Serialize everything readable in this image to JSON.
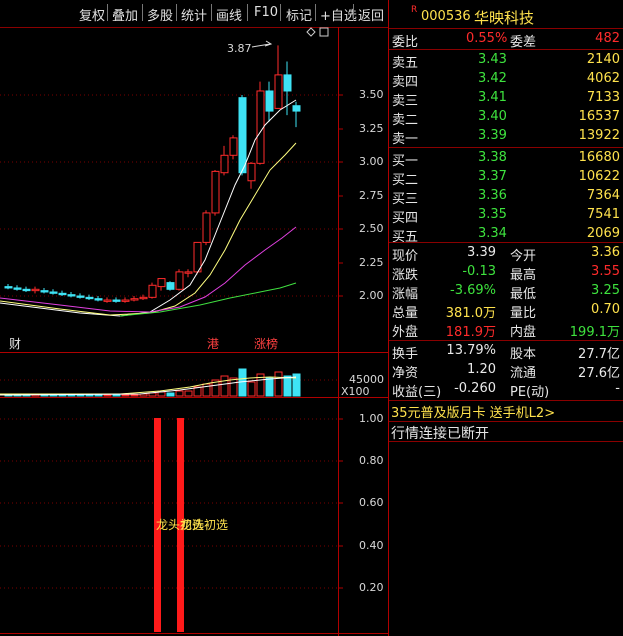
{
  "toolbar": {
    "items": [
      "复权",
      "叠加",
      "多股",
      "统计",
      "画线",
      "F10",
      "标记",
      "+自选",
      "返回"
    ]
  },
  "stock": {
    "badge": "R",
    "code": "000536",
    "name": "华映科技"
  },
  "kchart": {
    "high_note": "3.87",
    "price_ticks": [
      "3.50",
      "3.25",
      "3.00",
      "2.75",
      "2.50",
      "2.25",
      "2.00"
    ],
    "markers": {
      "cai": "财",
      "gang": "港",
      "zhangbang": "涨榜"
    },
    "volume_tick": "45000",
    "volume_unit": "X100"
  },
  "indicator": {
    "ticks": [
      "1.00",
      "0.80",
      "0.60",
      "0.40",
      "0.20"
    ],
    "signal_label": "龙头初选",
    "signal_label2": "龙头初选"
  },
  "quote": {
    "weibi": {
      "label": "委比",
      "value": "0.55%"
    },
    "weicha": {
      "label": "委差",
      "value": "482"
    },
    "sell": [
      {
        "label": "卖五",
        "price": "3.43",
        "vol": "2140"
      },
      {
        "label": "卖四",
        "price": "3.42",
        "vol": "4062"
      },
      {
        "label": "卖三",
        "price": "3.41",
        "vol": "7133"
      },
      {
        "label": "卖二",
        "price": "3.40",
        "vol": "16537"
      },
      {
        "label": "卖一",
        "price": "3.39",
        "vol": "13922"
      }
    ],
    "buy": [
      {
        "label": "买一",
        "price": "3.38",
        "vol": "16680"
      },
      {
        "label": "买二",
        "price": "3.37",
        "vol": "10622"
      },
      {
        "label": "买三",
        "price": "3.36",
        "vol": "7364"
      },
      {
        "label": "买四",
        "price": "3.35",
        "vol": "7541"
      },
      {
        "label": "买五",
        "price": "3.34",
        "vol": "2069"
      }
    ],
    "stats": [
      {
        "l1": "现价",
        "v1": "3.39",
        "l2": "今开",
        "v2": "3.36"
      },
      {
        "l1": "涨跌",
        "v1": "-0.13",
        "l2": "最高",
        "v2": "3.55"
      },
      {
        "l1": "涨幅",
        "v1": "-3.69%",
        "l2": "最低",
        "v2": "3.25"
      },
      {
        "l1": "总量",
        "v1": "381.0万",
        "l2": "量比",
        "v2": "0.70"
      },
      {
        "l1": "外盘",
        "v1": "181.9万",
        "l2": "内盘",
        "v2": "199.1万"
      },
      {
        "l1": "换手",
        "v1": "13.79%",
        "l2": "股本",
        "v2": "27.7亿"
      },
      {
        "l1": "净资",
        "v1": "1.20",
        "l2": "流通",
        "v2": "27.6亿"
      },
      {
        "l1": "收益(三)",
        "v1": "-0.260",
        "l2": "PE(动)",
        "v2": "-"
      }
    ],
    "promo": "35元普及版月卡 送手机L2>",
    "status": "行情连接已断开"
  },
  "colors": {
    "up": "#ff2b2b",
    "down": "#3ee3f5",
    "ma5": "#ffffff",
    "ma10": "#ffff80",
    "ma20": "#e040e0",
    "ma60": "#40e040",
    "border": "#b00000"
  }
}
